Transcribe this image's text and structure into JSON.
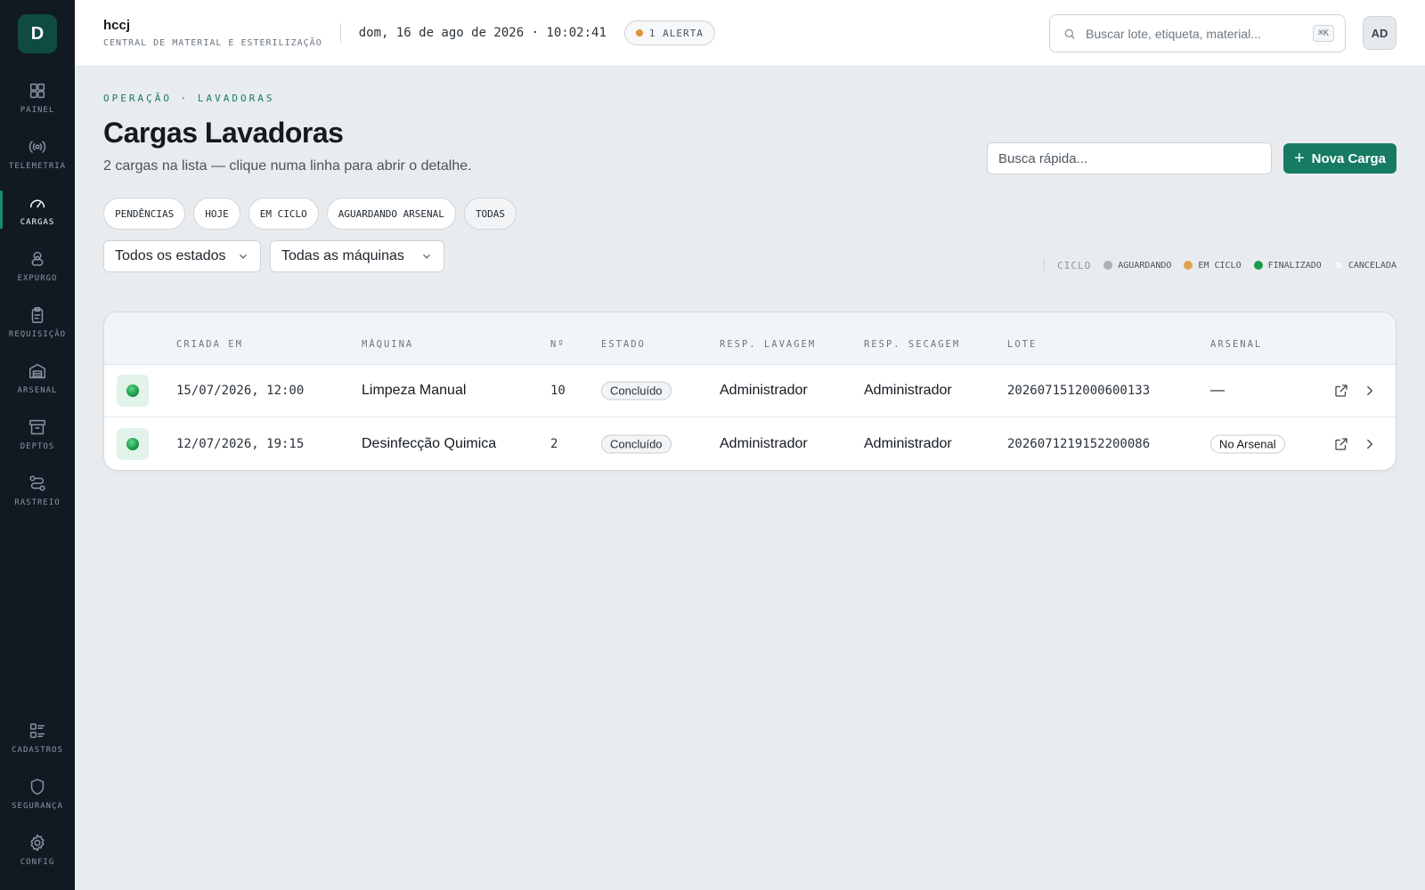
{
  "app": {
    "logo_letter": "D",
    "name": "hccj",
    "subtitle": "CENTRAL DE MATERIAL E ESTERILIZAÇÃO",
    "clock": "dom, 16 de ago de 2026 · 10:02:41",
    "alert_label": "1 ALERTA",
    "alert_color": "#e0903a",
    "search_placeholder": "Buscar lote, etiqueta, material...",
    "search_shortcut": "⌘K",
    "avatar_initials": "AD"
  },
  "sidebar": {
    "items": [
      {
        "label": "PAINEL",
        "icon": "grid-icon"
      },
      {
        "label": "TELEMETRIA",
        "icon": "broadcast-icon"
      },
      {
        "label": "CARGAS",
        "icon": "gauge-icon",
        "active": true
      },
      {
        "label": "EXPURGO",
        "icon": "biohazard-icon"
      },
      {
        "label": "REQUISIÇÃO",
        "icon": "clipboard-icon"
      },
      {
        "label": "ARSENAL",
        "icon": "warehouse-icon"
      },
      {
        "label": "DEPTOS",
        "icon": "archive-icon"
      },
      {
        "label": "RASTREIO",
        "icon": "route-icon"
      }
    ],
    "bottom_items": [
      {
        "label": "CADASTROS",
        "icon": "list-icon"
      },
      {
        "label": "SEGURANÇA",
        "icon": "shield-icon"
      },
      {
        "label": "CONFIG",
        "icon": "gear-icon"
      }
    ]
  },
  "page": {
    "eyebrow": "OPERAÇÃO · LAVADORAS",
    "title": "Cargas Lavadoras",
    "subtitle": "2 cargas na lista — clique numa linha para abrir o detalhe.",
    "quick_search_placeholder": "Busca rápida...",
    "new_button": "Nova Carga",
    "accent": "#177a62"
  },
  "chips": [
    "PENDÊNCIAS",
    "HOJE",
    "EM CICLO",
    "AGUARDANDO ARSENAL",
    "TODAS"
  ],
  "filters": {
    "state": "Todos os estados",
    "machine": "Todas as máquinas"
  },
  "legend": {
    "title": "CICLO",
    "items": [
      {
        "label": "AGUARDANDO",
        "color": "#a8b0b8"
      },
      {
        "label": "EM CICLO",
        "color": "#e0a050"
      },
      {
        "label": "FINALIZADO",
        "color": "#1a9a4a"
      },
      {
        "label": "CANCELADA",
        "color": "#f4f6f8"
      }
    ]
  },
  "table": {
    "columns": [
      "CRIADA EM",
      "MÁQUINA",
      "Nº",
      "ESTADO",
      "RESP. LAVAGEM",
      "RESP. SECAGEM",
      "LOTE",
      "ARSENAL"
    ],
    "rows": [
      {
        "created": "15/07/2026, 12:00",
        "machine": "Limpeza Manual",
        "number": "10",
        "state": "Concluído",
        "resp_wash": "Administrador",
        "resp_dry": "Administrador",
        "lot": "2026071512000600133",
        "arsenal": "—"
      },
      {
        "created": "12/07/2026, 19:15",
        "machine": "Desinfecção Quimica",
        "number": "2",
        "state": "Concluído",
        "resp_wash": "Administrador",
        "resp_dry": "Administrador",
        "lot": "2026071219152200086",
        "arsenal": "No Arsenal"
      }
    ]
  }
}
